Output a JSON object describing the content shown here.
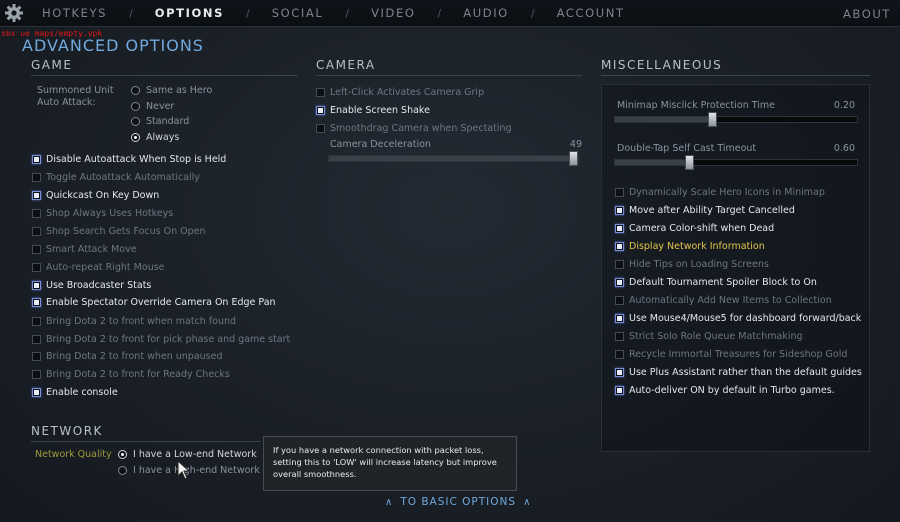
{
  "topbar": {
    "gear_icon": "gear-icon",
    "tabs": [
      "HOTKEYS",
      "OPTIONS",
      "SOCIAL",
      "VIDEO",
      "AUDIO",
      "ACCOUNT"
    ],
    "active_tab": "OPTIONS",
    "about": "ABOUT"
  },
  "overlay_error": "sbx ue maps/empty.vpk",
  "page_title": "ADVANCED OPTIONS",
  "game": {
    "title": "GAME",
    "summoned_label_1": "Summoned Unit",
    "summoned_label_2": "Auto Attack:",
    "summoned_options": [
      "Same as Hero",
      "Never",
      "Standard",
      "Always"
    ],
    "summoned_selected": "Always",
    "options": [
      {
        "label": "Disable Autoattack When Stop is Held",
        "checked": true
      },
      {
        "label": "Toggle Autoattack Automatically",
        "checked": false
      },
      {
        "label": "Quickcast On Key Down",
        "checked": true
      },
      {
        "label": "Shop Always Uses Hotkeys",
        "checked": false
      },
      {
        "label": "Shop Search Gets Focus On Open",
        "checked": false
      },
      {
        "label": "Smart Attack Move",
        "checked": false
      },
      {
        "label": "Auto-repeat Right Mouse",
        "checked": false
      },
      {
        "label": "Use Broadcaster Stats",
        "checked": true
      },
      {
        "label": "Enable Spectator Override Camera On Edge Pan",
        "checked": true
      },
      {
        "label": "Bring Dota 2 to front when match found",
        "checked": false
      },
      {
        "label": "Bring Dota 2 to front for pick phase and game start",
        "checked": false
      },
      {
        "label": "Bring Dota 2 to front when unpaused",
        "checked": false
      },
      {
        "label": "Bring Dota 2 to front for Ready Checks",
        "checked": false
      },
      {
        "label": "Enable console",
        "checked": true
      }
    ]
  },
  "camera": {
    "title": "CAMERA",
    "options": [
      {
        "label": "Left-Click Activates Camera Grip",
        "checked": false
      },
      {
        "label": "Enable Screen Shake",
        "checked": true
      },
      {
        "label": "Smoothdrag Camera when Spectating",
        "checked": false
      }
    ],
    "deceleration_label": "Camera Deceleration",
    "deceleration_value": "49",
    "deceleration_level": 1.0
  },
  "misc": {
    "title": "MISCELLANEOUS",
    "minimap_label": "Minimap Misclick Protection Time",
    "minimap_value": "0.20",
    "minimap_level": 0.4,
    "doubletap_label": "Double-Tap Self Cast Timeout",
    "doubletap_value": "0.60",
    "doubletap_level": 0.3,
    "options": [
      {
        "label": "Dynamically Scale Hero Icons in Minimap",
        "checked": false
      },
      {
        "label": "Move after Ability Target Cancelled",
        "checked": true
      },
      {
        "label": "Camera Color-shift when Dead",
        "checked": true
      },
      {
        "label": "Display Network Information",
        "checked": true,
        "highlight": true
      },
      {
        "label": "Hide Tips on Loading Screens",
        "checked": false
      },
      {
        "label": "Default Tournament Spoiler Block to On",
        "checked": true
      },
      {
        "label": "Automatically Add New Items to Collection",
        "checked": false
      },
      {
        "label": "Use Mouse4/Mouse5 for dashboard forward/back",
        "checked": true
      },
      {
        "label": "Strict Solo Role Queue Matchmaking",
        "checked": false
      },
      {
        "label": "Recycle Immortal Treasures for Sideshop Gold",
        "checked": false
      },
      {
        "label": "Use Plus Assistant rather than the default guides",
        "checked": true
      },
      {
        "label": "Auto-deliver ON by default in Turbo games.",
        "checked": true
      }
    ]
  },
  "network": {
    "title": "NETWORK",
    "quality_label": "Network Quality",
    "options": [
      "I have a Low-end Network",
      "I have a High-end Network"
    ],
    "selected": "I have a Low-end Network",
    "tooltip": "If you have a network connection with packet loss, setting this to 'LOW' will increase latency but improve overall smoothness."
  },
  "basic_link": "TO BASIC OPTIONS",
  "colors": {
    "accent_blue": "#6fa9dd",
    "highlight_gold": "#e0c54a",
    "error_red": "#e01616"
  }
}
